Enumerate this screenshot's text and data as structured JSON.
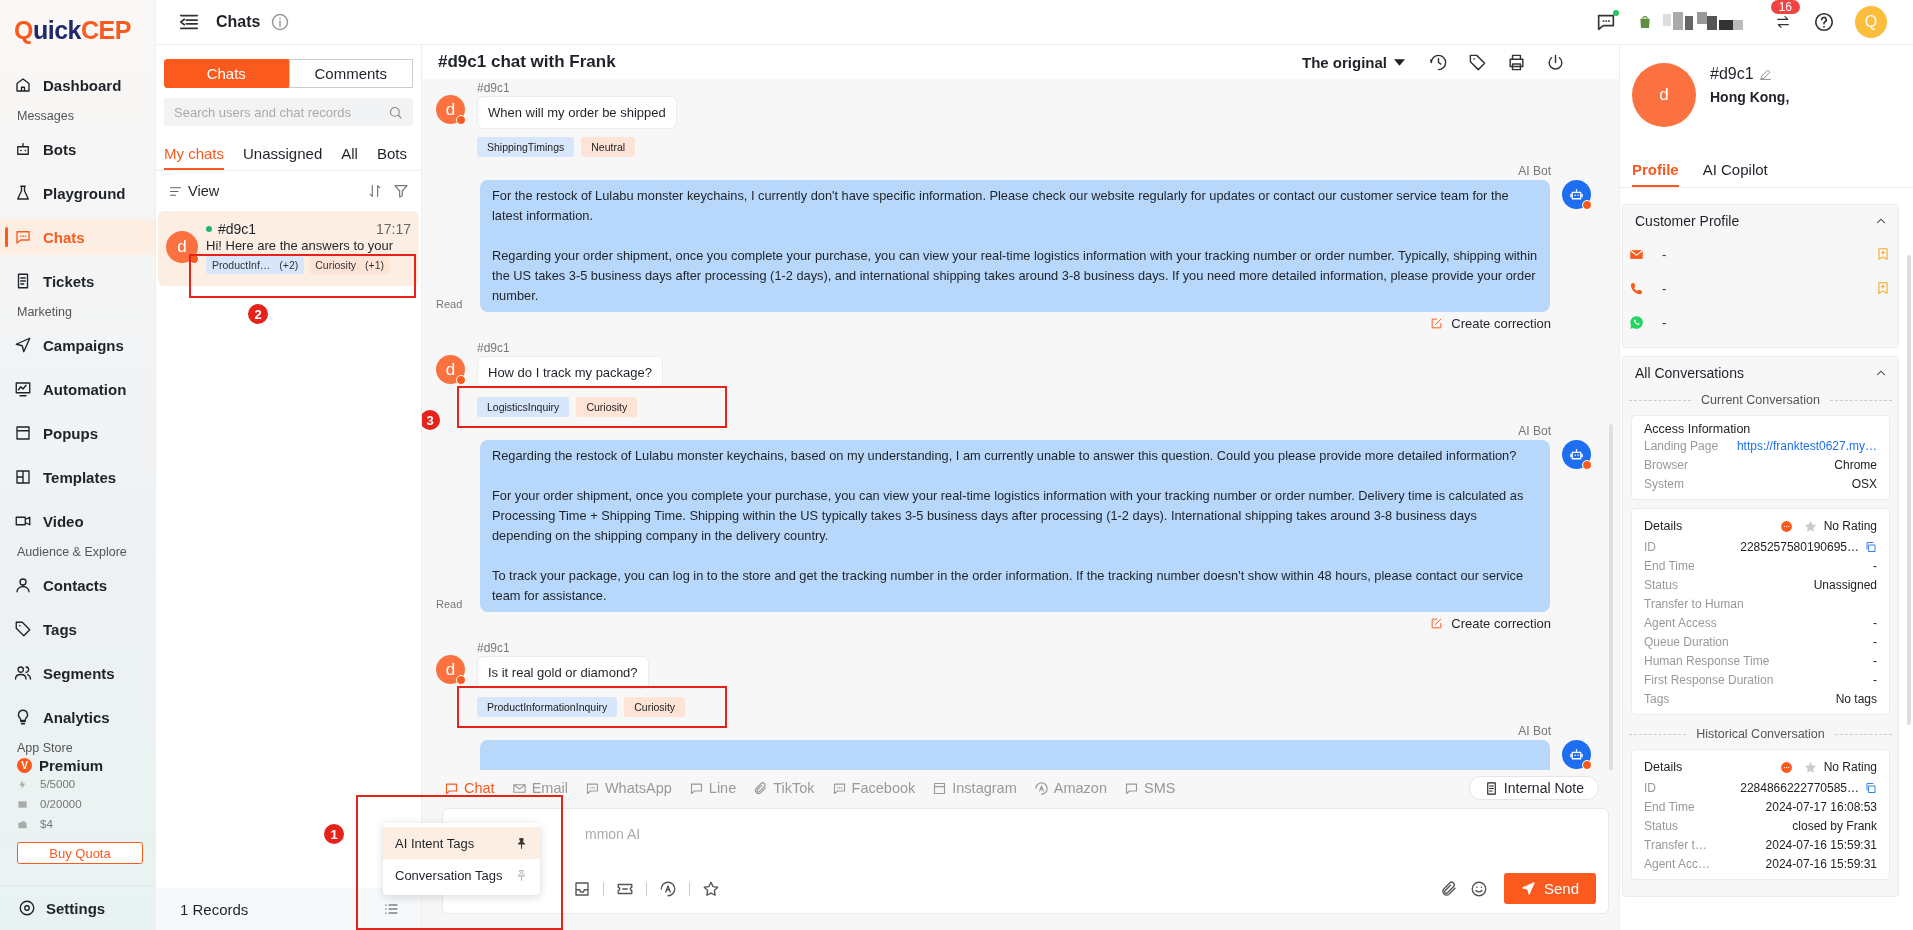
{
  "logo": [
    "Q",
    "uick",
    "CEP"
  ],
  "nav": [
    {
      "kind": "link",
      "label": "Dashboard",
      "selected": false
    },
    {
      "kind": "section",
      "label": "Messages"
    },
    {
      "kind": "link",
      "label": "Bots",
      "selected": false
    },
    {
      "kind": "link",
      "label": "Playground",
      "selected": false
    },
    {
      "kind": "link",
      "label": "Chats",
      "selected": true
    },
    {
      "kind": "link",
      "label": "Tickets",
      "selected": false
    },
    {
      "kind": "section",
      "label": "Marketing"
    },
    {
      "kind": "link",
      "label": "Campaigns",
      "selected": false
    },
    {
      "kind": "link",
      "label": "Automation",
      "selected": false
    },
    {
      "kind": "link",
      "label": "Popups",
      "selected": false
    },
    {
      "kind": "link",
      "label": "Templates",
      "selected": false
    },
    {
      "kind": "link",
      "label": "Video",
      "selected": false
    },
    {
      "kind": "section",
      "label": "Audience & Explore"
    },
    {
      "kind": "link",
      "label": "Contacts",
      "selected": false
    },
    {
      "kind": "link",
      "label": "Tags",
      "selected": false
    },
    {
      "kind": "link",
      "label": "Segments",
      "selected": false
    },
    {
      "kind": "link",
      "label": "Analytics",
      "selected": false
    },
    {
      "kind": "section",
      "label": "App Store"
    }
  ],
  "plan": {
    "badge": "V",
    "name": "Premium",
    "quotas": [
      "5/5000",
      "0/20000",
      "$4"
    ],
    "button": "Buy Quota"
  },
  "settings": "Settings",
  "top_bar": {
    "title": "Chats",
    "badge": "16",
    "avatar": "Q"
  },
  "chat_list": {
    "modes": [
      {
        "label": "Chats",
        "selected": true
      },
      {
        "label": "Comments",
        "selected": false
      }
    ],
    "search": {
      "placeholder": "Search users and chat records"
    },
    "tabs": [
      {
        "label": "My chats",
        "selected": true
      },
      {
        "label": "Unassigned",
        "selected": false
      },
      {
        "label": "All",
        "selected": false
      },
      {
        "label": "Bots",
        "selected": false
      }
    ],
    "view": "View",
    "chats": [
      {
        "avatar": "d",
        "name": "#d9c1",
        "time": "17:17",
        "preview": "Hi! Here are the answers to your",
        "selected": true,
        "callout": "2",
        "tags": [
          {
            "label": "ProductInf…",
            "extra": "(+2)",
            "color": "#d7e6fb"
          },
          {
            "label": "Curiosity",
            "extra": "(+1)",
            "color": "#fde4d6"
          }
        ]
      }
    ],
    "footer": "1 Records"
  },
  "tag_menu": {
    "callout": "1",
    "items": [
      {
        "label": "AI Intent Tags",
        "selected": true,
        "pinned": true
      },
      {
        "label": "Conversation Tags",
        "selected": false,
        "pinned": false
      }
    ]
  },
  "conversation": {
    "title": "#d9c1 chat with Frank",
    "translation": "The original",
    "messages": [
      {
        "kind": "customer",
        "avatar": "d",
        "sender": "#d9c1",
        "text": "When will my order be shipped",
        "highlighted": false,
        "tags": [
          {
            "label": "ShippingTimings",
            "color": "#d7e6fb"
          },
          {
            "label": "Neutral",
            "color": "#fde4d6"
          }
        ]
      },
      {
        "kind": "bot",
        "sender": "AI Bot",
        "status": "Read",
        "action": "Create correction",
        "paragraphs": [
          "For the restock of Lulabu monster keychains, I currently don't have specific information. Please check our website regularly for updates or contact our customer service team for the latest information.",
          "Regarding your order shipment, once you complete your purchase, you can view your real-time logistics information with your tracking number or order number. Typically, shipping within the US takes 3-5 business days after processing (1-2 days), and international shipping takes around 3-8 business days. If you need more detailed information, please provide your order number."
        ]
      },
      {
        "kind": "customer",
        "avatar": "d",
        "sender": "#d9c1",
        "text": "How do I track my package?",
        "highlighted": true,
        "callout": "3",
        "tags": [
          {
            "label": "LogisticsInquiry",
            "color": "#d7e6fb"
          },
          {
            "label": "Curiosity",
            "color": "#fde4d6"
          }
        ]
      },
      {
        "kind": "bot",
        "sender": "AI Bot",
        "status": "Read",
        "action": "Create correction",
        "paragraphs": [
          "Regarding the restock of Lulabu monster keychains, based on my understanding, I am currently unable to answer this question. Could you please provide more detailed information?",
          "For your order shipment, once you complete your purchase, you can view your real-time logistics information with your tracking number or order number. Delivery time is calculated as Processing Time + Shipping Time. Shipping within the US typically takes 3-5 business days after processing (1-2 days). International shipping takes around 3-8 business days depending on the shipping company in the delivery country.",
          "To track your package, you can log in to the store and get the tracking number in the order information. If the tracking number doesn't show within 48 hours, please contact our service team for assistance."
        ]
      },
      {
        "kind": "customer",
        "avatar": "d",
        "sender": "#d9c1",
        "text": "Is it real gold or diamond?",
        "highlighted": true,
        "tags": [
          {
            "label": "ProductInformationInquiry",
            "color": "#d7e6fb"
          },
          {
            "label": "Curiosity",
            "color": "#fde4d6"
          }
        ]
      },
      {
        "kind": "bot",
        "sender": "AI Bot"
      }
    ],
    "channels": [
      {
        "label": "Chat",
        "selected": true
      },
      {
        "label": "Email",
        "selected": false
      },
      {
        "label": "WhatsApp",
        "selected": false
      },
      {
        "label": "Line",
        "selected": false
      },
      {
        "label": "TikTok",
        "selected": false
      },
      {
        "label": "Facebook",
        "selected": false
      },
      {
        "label": "Instagram",
        "selected": false
      },
      {
        "label": "Amazon",
        "selected": false
      },
      {
        "label": "SMS",
        "selected": false
      }
    ],
    "internal_note": "Internal Note",
    "input": {
      "placeholder": "mmon AI"
    },
    "send": "Send"
  },
  "profile": {
    "avatar": "d",
    "name": "#d9c1",
    "location": "Hong Kong,",
    "tabs": [
      {
        "label": "Profile",
        "selected": true
      },
      {
        "label": "AI Copilot",
        "selected": false
      }
    ],
    "customer_profile": {
      "title": "Customer Profile",
      "fields": [
        {
          "kind": "email",
          "value": "-",
          "bookmark": true
        },
        {
          "kind": "phone",
          "value": "-",
          "bookmark": true
        },
        {
          "kind": "whatsapp",
          "value": "-",
          "bookmark": false
        }
      ]
    },
    "conversations": {
      "title": "All Conversations",
      "current": {
        "label": "Current Conversation",
        "access": {
          "title": "Access Information",
          "rows": [
            {
              "label": "Landing Page",
              "value": "https://franktest0627.my…",
              "kind": "link"
            },
            {
              "label": "Browser",
              "value": "Chrome",
              "kind": "text"
            },
            {
              "label": "System",
              "value": "OSX",
              "kind": "text"
            }
          ]
        },
        "details": {
          "title": "Details",
          "rating": "No Rating",
          "rows": [
            {
              "label": "ID",
              "value": "2285257580190695…",
              "copyable": true
            },
            {
              "label": "End Time",
              "value": "-",
              "copyable": false
            },
            {
              "label": "Status",
              "value": "Unassigned",
              "copyable": false
            },
            {
              "label": "Transfer to Human",
              "copyable": false
            },
            {
              "label": "Agent Access",
              "value": "-",
              "copyable": false
            },
            {
              "label": "Queue Duration",
              "value": "-",
              "copyable": false
            },
            {
              "label": "Human Response Time",
              "value": "-",
              "copyable": false
            },
            {
              "label": "First Response Duration",
              "value": "-",
              "copyable": false
            },
            {
              "label": "Tags",
              "value": "No tags",
              "copyable": false
            }
          ]
        }
      },
      "historical": {
        "label": "Historical Conversation",
        "details": {
          "title": "Details",
          "rating": "No Rating",
          "rows": [
            {
              "label": "ID",
              "value": "2284866222770585…",
              "copyable": true
            },
            {
              "label": "End Time",
              "value": "2024-07-17 16:08:53",
              "copyable": false
            },
            {
              "label": "Status",
              "value": "closed by Frank",
              "copyable": false
            },
            {
              "label": "Transfer t…",
              "value": "2024-07-16 15:59:31",
              "copyable": false
            },
            {
              "label": "Agent Acc…",
              "value": "2024-07-16 15:59:31",
              "copyable": false
            }
          ]
        }
      }
    }
  }
}
